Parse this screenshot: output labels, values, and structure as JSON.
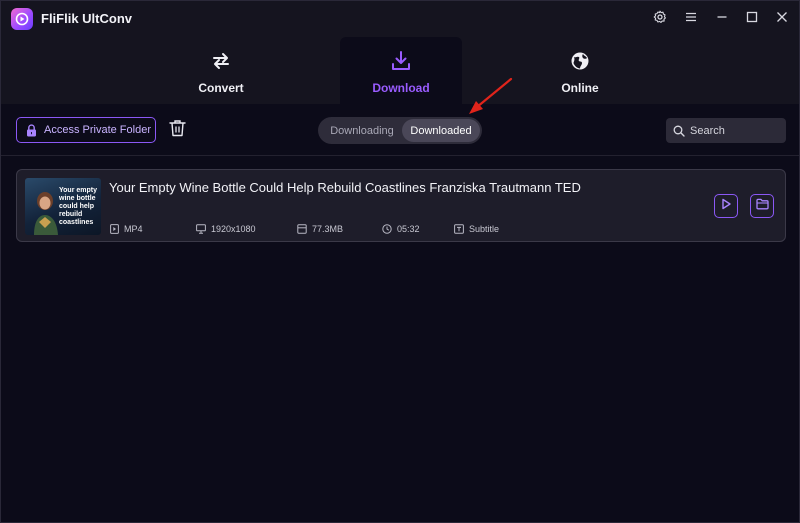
{
  "app": {
    "title": "FliFlik UltConv"
  },
  "nav": {
    "tabs": [
      {
        "label": "Convert",
        "icon": "convert-arrows-icon",
        "active": false
      },
      {
        "label": "Download",
        "icon": "download-icon",
        "active": true
      },
      {
        "label": "Online",
        "icon": "globe-icon",
        "active": false
      }
    ]
  },
  "toolbar": {
    "private_folder_label": "Access Private Folder",
    "segments": [
      {
        "label": "Downloading",
        "active": false
      },
      {
        "label": "Downloaded",
        "active": true
      }
    ],
    "search_placeholder": "Search"
  },
  "items": [
    {
      "title": "Your Empty Wine Bottle Could Help Rebuild Coastlines Franziska Trautmann TED",
      "thumbnail_text": "Your empty wine bottle could help rebuild coastlines",
      "format": "MP4",
      "resolution": "1920x1080",
      "size": "77.3MB",
      "duration": "05:32",
      "subtitle": "Subtitle"
    }
  ],
  "colors": {
    "accent": "#8b58f5",
    "active_tab_label": "#9a5cff",
    "background": "#0c0b19",
    "annotation_arrow": "#e0241b"
  }
}
